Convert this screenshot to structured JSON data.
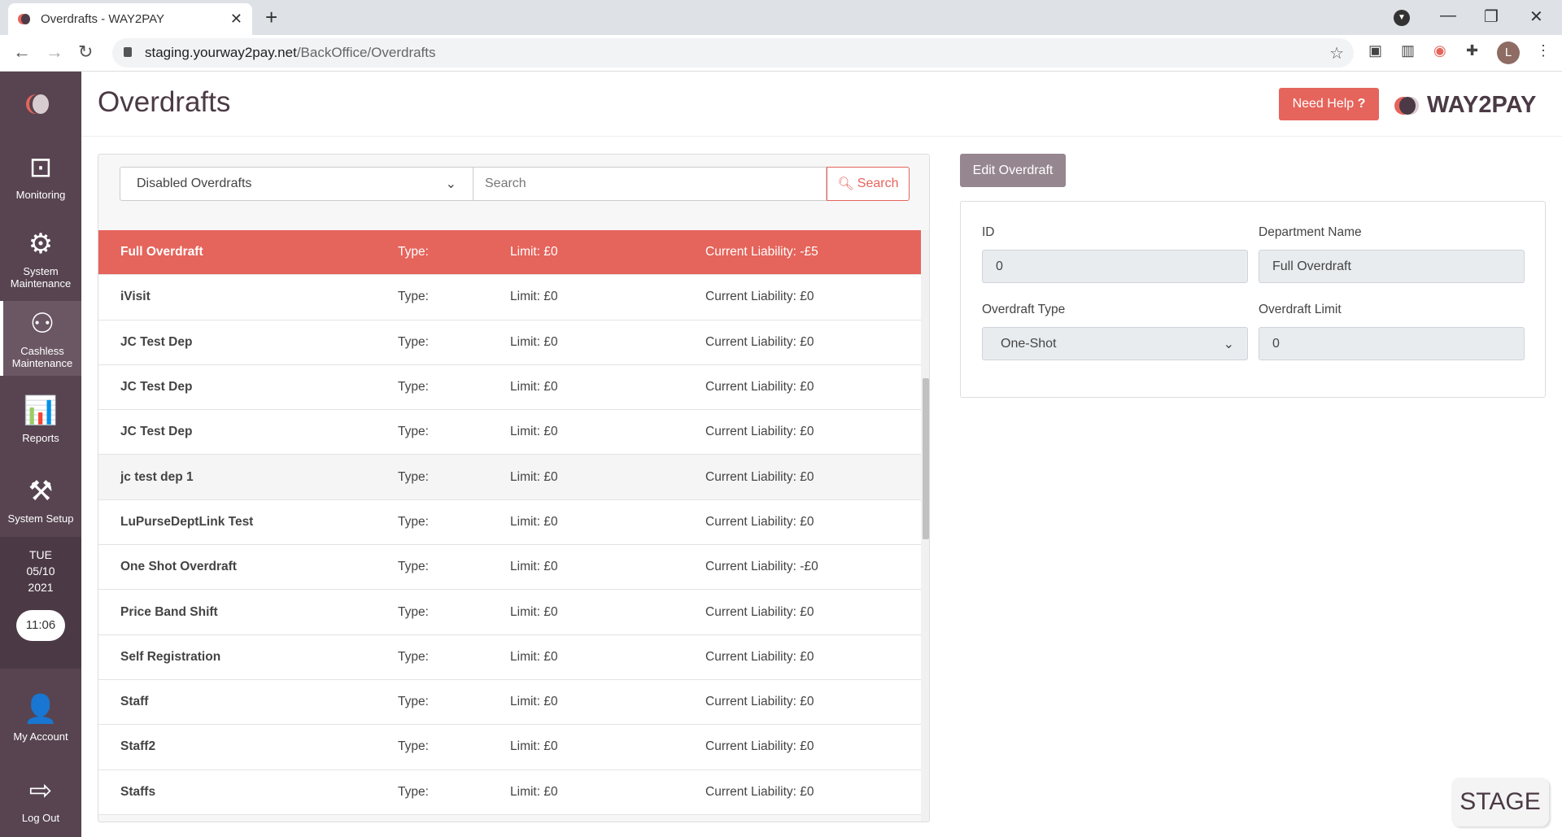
{
  "browser": {
    "tab_title": "Overdrafts - WAY2PAY",
    "url_host": "staging.yourway2pay.net",
    "url_path": "/BackOffice/Overdrafts",
    "profile_initial": "L"
  },
  "sidebar": {
    "items": [
      {
        "label": "Monitoring",
        "icon": "monitor-pulse-icon"
      },
      {
        "label": "System Maintenance",
        "icon": "gear-icon"
      },
      {
        "label": "Cashless Maintenance",
        "icon": "users-gear-icon",
        "active": true
      },
      {
        "label": "Reports",
        "icon": "chart-icon"
      },
      {
        "label": "System Setup",
        "icon": "tools-icon"
      },
      {
        "label": "My Account",
        "icon": "user-icon"
      },
      {
        "label": "Log Out",
        "icon": "logout-icon"
      }
    ],
    "day": "TUE",
    "date": "05/10",
    "year": "2021",
    "time": "11:06"
  },
  "header": {
    "title": "Overdrafts",
    "help_label": "Need Help",
    "brand": "WAY2PAY"
  },
  "filter": {
    "selected": "Disabled Overdrafts",
    "search_placeholder": "Search",
    "search_button": "Search"
  },
  "rows": [
    {
      "name": "Full Overdraft",
      "type": "Type:",
      "limit": "Limit: £0",
      "liability": "Current Liability: -£5"
    },
    {
      "name": "iVisit",
      "type": "Type:",
      "limit": "Limit: £0",
      "liability": "Current Liability: £0"
    },
    {
      "name": "JC Test Dep",
      "type": "Type:",
      "limit": "Limit: £0",
      "liability": "Current Liability: £0"
    },
    {
      "name": "JC Test Dep",
      "type": "Type:",
      "limit": "Limit: £0",
      "liability": "Current Liability: £0"
    },
    {
      "name": "JC Test Dep",
      "type": "Type:",
      "limit": "Limit: £0",
      "liability": "Current Liability: £0"
    },
    {
      "name": "jc test dep 1",
      "type": "Type:",
      "limit": "Limit: £0",
      "liability": "Current Liability: £0"
    },
    {
      "name": "LuPurseDeptLink Test",
      "type": "Type:",
      "limit": "Limit: £0",
      "liability": "Current Liability: £0"
    },
    {
      "name": "One Shot Overdraft",
      "type": "Type:",
      "limit": "Limit: £0",
      "liability": "Current Liability: -£0"
    },
    {
      "name": "Price Band Shift",
      "type": "Type:",
      "limit": "Limit: £0",
      "liability": "Current Liability: £0"
    },
    {
      "name": "Self Registration",
      "type": "Type:",
      "limit": "Limit: £0",
      "liability": "Current Liability: £0"
    },
    {
      "name": "Staff",
      "type": "Type:",
      "limit": "Limit: £0",
      "liability": "Current Liability: £0"
    },
    {
      "name": "Staff2",
      "type": "Type:",
      "limit": "Limit: £0",
      "liability": "Current Liability: £0"
    },
    {
      "name": "Staffs",
      "type": "Type:",
      "limit": "Limit: £0",
      "liability": "Current Liability: £0"
    }
  ],
  "edit": {
    "button": "Edit Overdraft",
    "id_label": "ID",
    "id_value": "0",
    "dept_label": "Department Name",
    "dept_value": "Full Overdraft",
    "type_label": "Overdraft Type",
    "type_value": "One-Shot",
    "limit_label": "Overdraft Limit",
    "limit_value": "0"
  },
  "env_badge": "STAGE",
  "colors": {
    "accent": "#e5645b",
    "sidebar": "#574450",
    "edit_button": "#968690"
  }
}
